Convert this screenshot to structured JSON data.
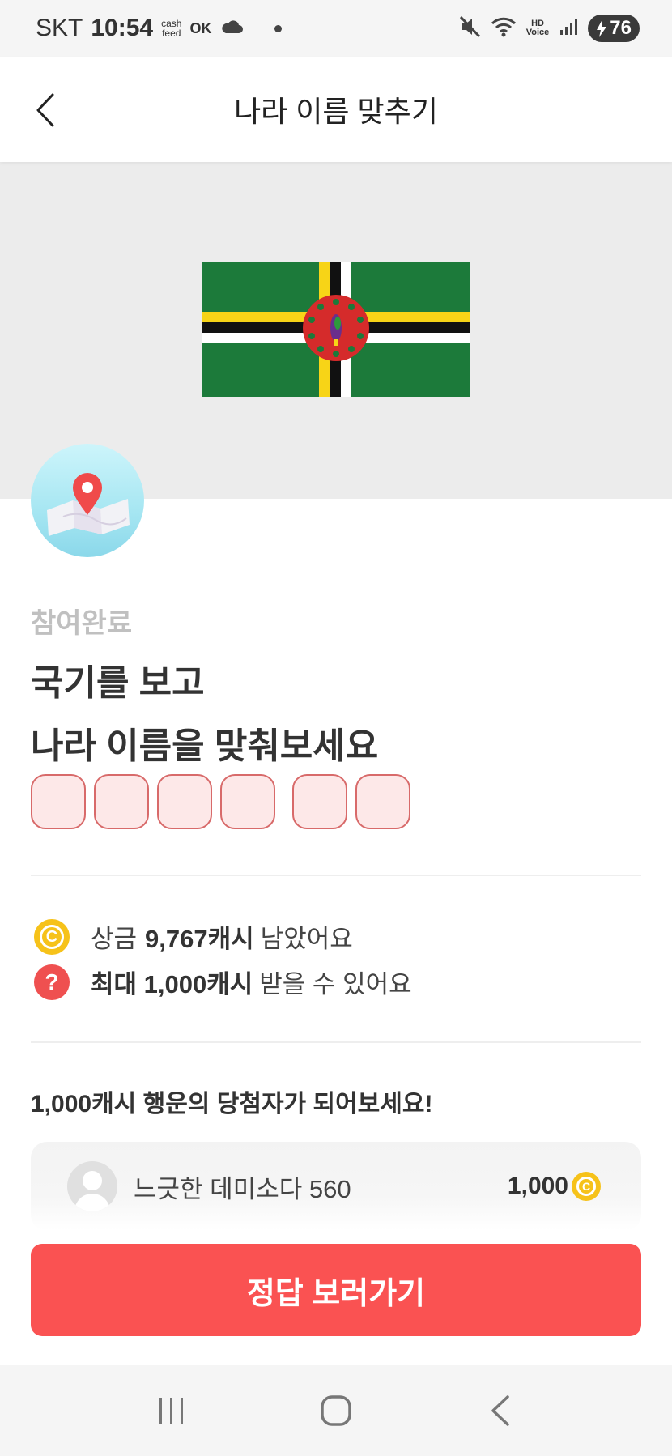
{
  "status_bar": {
    "carrier": "SKT",
    "time": "10:54",
    "app_logo_top": "cash",
    "app_logo_bottom": "feed",
    "ok_logo": "OK",
    "voice_label_top": "HD",
    "voice_label_bottom": "Voice",
    "battery": "76",
    "icons": [
      "cloud-icon",
      "mute-icon",
      "wifi-icon",
      "signal-icon",
      "charging-icon"
    ]
  },
  "header": {
    "title": "나라 이름 맞추기",
    "back_icon": "chevron-left-icon"
  },
  "quiz": {
    "status": "참여완료",
    "question_line1": "국기를 보고",
    "question_line2": "나라 이름을 맞춰보세요",
    "answer_groups": [
      4,
      2
    ],
    "flag_colors": {
      "green": "#1c7a3a",
      "yellow": "#f7d417",
      "black": "#111111",
      "white": "#ffffff",
      "red": "#d52b2b"
    }
  },
  "info": {
    "prize_icon": "coin-icon",
    "prize_prefix": "상금",
    "prize_bold": "9,767캐시",
    "prize_suffix": "남았어요",
    "max_icon": "question-icon",
    "max_bold": "최대 1,000캐시",
    "max_suffix": "받을 수 있어요"
  },
  "winners": {
    "title": "1,000캐시 행운의 당첨자가 되어보세요!",
    "list": [
      {
        "name": "느긋한 데미소다 560",
        "amount": "1,000"
      }
    ]
  },
  "cta": {
    "label": "정답 보러가기",
    "color": "#fa5252"
  },
  "nav": {
    "items": [
      "recent-apps-icon",
      "home-icon",
      "back-icon"
    ]
  }
}
